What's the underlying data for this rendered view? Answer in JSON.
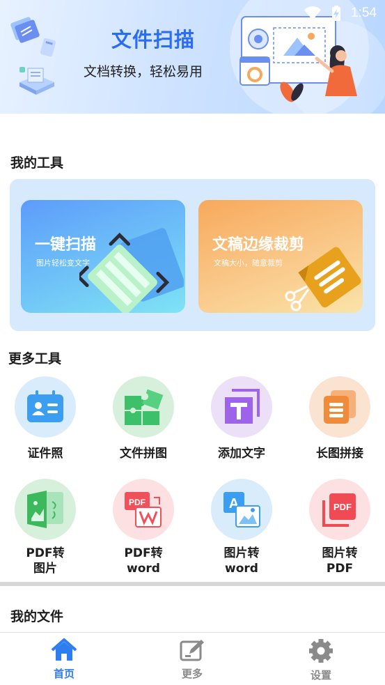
{
  "status_bar": {
    "time": "1:54"
  },
  "banner": {
    "title": "文件扫描",
    "subtitle": "文档转换，轻松易用",
    "illustration_icon": "woman-with-document-board-illustration"
  },
  "my_tools": {
    "title": "我的工具",
    "cards": [
      {
        "title": "一键扫描",
        "subtitle": "图片轻松变文字",
        "icon": "scan-frame-icon"
      },
      {
        "title": "文稿边缘裁剪",
        "subtitle": "文稿大小，随意裁剪",
        "icon": "scissors-document-icon"
      }
    ]
  },
  "more_tools": {
    "title": "更多工具",
    "items": [
      {
        "label": "证件照",
        "icon": "id-card-icon",
        "bg": "#d8ecfb",
        "color": "#3b9ef0"
      },
      {
        "label": "文件拼图",
        "icon": "puzzle-icon",
        "bg": "#d6f0dc",
        "color": "#3cc06a"
      },
      {
        "label": "添加文字",
        "icon": "text-t-icon",
        "bg": "#ebe0f8",
        "color": "#9d63e8"
      },
      {
        "label": "长图拼接",
        "icon": "long-image-icon",
        "bg": "#fbe3d2",
        "color": "#f08b3c"
      },
      {
        "label": "PDF转\n图片",
        "icon": "pdf-to-image-icon",
        "bg": "#d6f0dc",
        "color": "#3cb95c"
      },
      {
        "label": "PDF转\nword",
        "icon": "pdf-to-word-icon",
        "bg": "#fde0e2",
        "color": "#f0505a"
      },
      {
        "label": "图片转\nword",
        "icon": "image-to-word-icon",
        "bg": "#d8ecfb",
        "color": "#3b9ef0"
      },
      {
        "label": "图片转\nPDF",
        "icon": "image-to-pdf-icon",
        "bg": "#fde0e2",
        "color": "#f04b55"
      }
    ]
  },
  "my_files": {
    "title": "我的文件"
  },
  "bottom_nav": {
    "items": [
      {
        "label": "首页",
        "icon": "home-icon",
        "active": true
      },
      {
        "label": "更多",
        "icon": "edit-icon",
        "active": false
      },
      {
        "label": "设置",
        "icon": "gear-icon",
        "active": false
      }
    ]
  },
  "colors": {
    "accent": "#2e7ef0",
    "muted": "#8a8a8a"
  }
}
